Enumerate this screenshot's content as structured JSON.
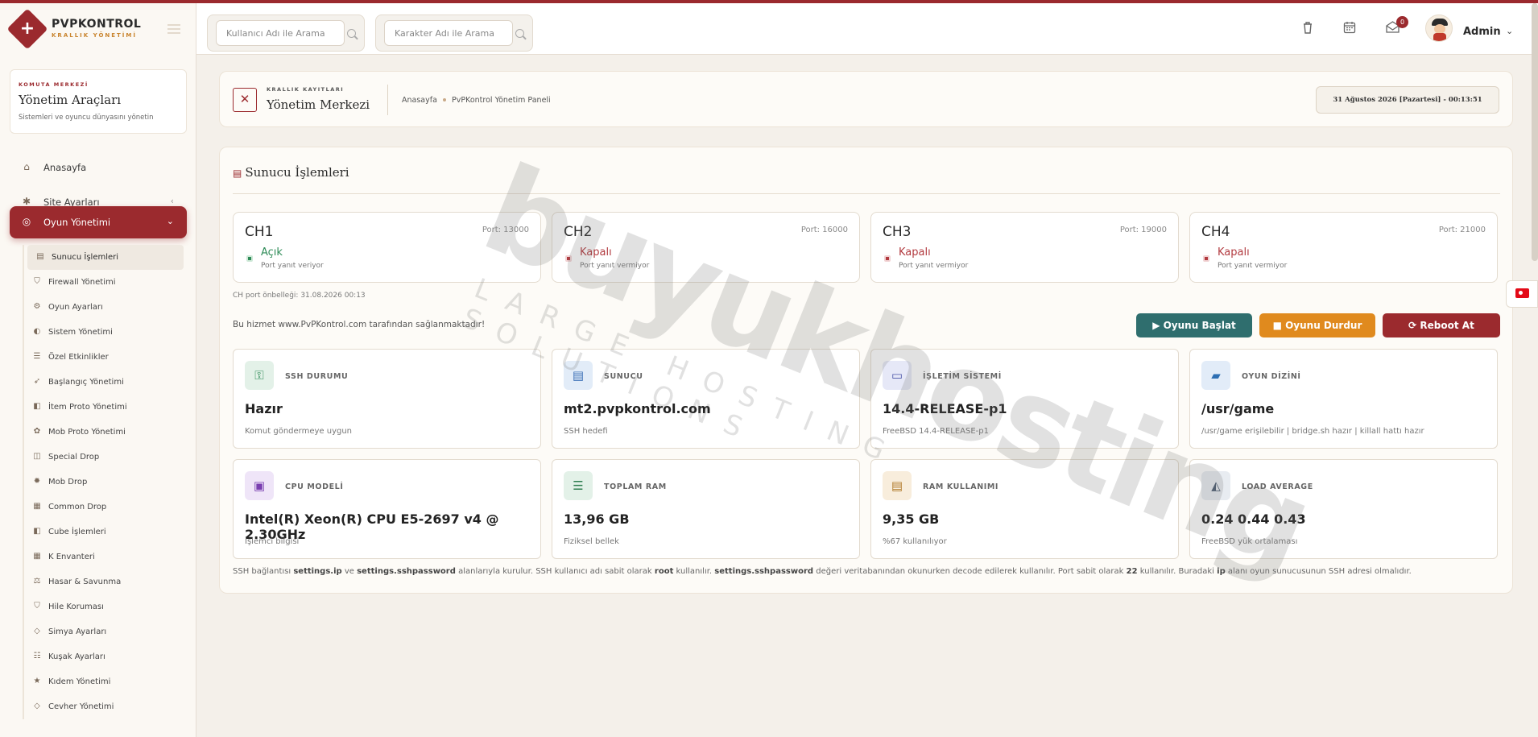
{
  "brand": {
    "title": "PVPKONTROL",
    "subtitle": "KRALLIK YÖNETİMİ"
  },
  "search": {
    "user_placeholder": "Kullanıcı Adı ile Arama",
    "character_placeholder": "Karakter Adı ile Arama"
  },
  "header": {
    "notification_count": "0",
    "admin_name": "Admin"
  },
  "sidebar": {
    "kicker": "KOMUTA MERKEZİ",
    "title": "Yönetim Araçları",
    "desc": "Sistemleri ve oyuncu dünyasını yönetin",
    "items": [
      {
        "label": "Anasayfa",
        "icon": "home-icon"
      },
      {
        "label": "Site Ayarları",
        "icon": "gear-icon"
      },
      {
        "label": "Oyun Yönetimi",
        "icon": "gamepad-icon"
      }
    ],
    "sub_items": [
      {
        "label": "Sunucu İşlemleri",
        "icon": "server-icon"
      },
      {
        "label": "Firewall Yönetimi",
        "icon": "shield-icon"
      },
      {
        "label": "Oyun Ayarları",
        "icon": "cogs-icon"
      },
      {
        "label": "Sistem Yönetimi",
        "icon": "toggle-icon"
      },
      {
        "label": "Özel Etkinlikler",
        "icon": "list-icon"
      },
      {
        "label": "Başlangıç Yönetimi",
        "icon": "rocket-icon"
      },
      {
        "label": "İtem Proto Yönetimi",
        "icon": "cube-icon"
      },
      {
        "label": "Mob Proto Yönetimi",
        "icon": "paw-icon"
      },
      {
        "label": "Special Drop",
        "icon": "gift-icon"
      },
      {
        "label": "Mob Drop",
        "icon": "bug-icon"
      },
      {
        "label": "Common Drop",
        "icon": "table-icon"
      },
      {
        "label": "Cube İşlemleri",
        "icon": "cube-icon"
      },
      {
        "label": "K Envanteri",
        "icon": "table-icon"
      },
      {
        "label": "Hasar & Savunma",
        "icon": "balance-icon"
      },
      {
        "label": "Hile Koruması",
        "icon": "shield-icon"
      },
      {
        "label": "Simya Ayarları",
        "icon": "diamond-icon"
      },
      {
        "label": "Kuşak Ayarları",
        "icon": "sliders-icon"
      },
      {
        "label": "Kıdem Yönetimi",
        "icon": "star-icon"
      },
      {
        "label": "Cevher Yönetimi",
        "icon": "diamond-icon"
      }
    ]
  },
  "page_header": {
    "kicker": "KRALLIK KAYITLARI",
    "title": "Yönetim Merkezi",
    "breadcrumb_home": "Anasayfa",
    "breadcrumb_current": "PvPKontrol Yönetim Paneli",
    "datetime": "31 Ağustos 2026 [Pazartesi] - 00:13:51"
  },
  "server": {
    "title": "Sunucu İşlemleri",
    "channels": [
      {
        "name": "CH1",
        "port": "Port: 13000",
        "status": "Açık",
        "note": "Port yanıt veriyor",
        "color": "#2e8b57"
      },
      {
        "name": "CH2",
        "port": "Port: 16000",
        "status": "Kapalı",
        "note": "Port yanıt vermiyor",
        "color": "#b23a3f"
      },
      {
        "name": "CH3",
        "port": "Port: 19000",
        "status": "Kapalı",
        "note": "Port yanıt vermiyor",
        "color": "#b23a3f"
      },
      {
        "name": "CH4",
        "port": "Port: 21000",
        "status": "Kapalı",
        "note": "Port yanıt vermiyor",
        "color": "#b23a3f"
      }
    ],
    "cache_note": "CH port önbelleği: 31.08.2026 00:13",
    "service_note": "Bu hizmet www.PvPKontrol.com tarafından sağlanmaktadır!",
    "buttons": {
      "start": "▶ Oyunu Başlat",
      "stop": "■ Oyunu Durdur",
      "reboot": "⟳ Reboot At",
      "start_color": "#2f6e6e",
      "stop_color": "#e08a1e",
      "reboot_color": "#9b2a2e"
    },
    "info_cards": [
      {
        "label": "SSH DURUMU",
        "value": "Hazır",
        "sub": "Komut göndermeye uygun",
        "icon": "key-icon"
      },
      {
        "label": "SUNUCU",
        "value": "mt2.pvpkontrol.com",
        "sub": "SSH hedefi",
        "icon": "server-icon"
      },
      {
        "label": "İŞLETİM SİSTEMİ",
        "value": "14.4-RELEASE-p1",
        "sub": "FreeBSD 14.4-RELEASE-p1",
        "icon": "monitor-icon"
      },
      {
        "label": "OYUN DİZİNİ",
        "value": "/usr/game",
        "sub": "/usr/game erişilebilir | bridge.sh hazır | killall hattı hazır",
        "icon": "folder-icon"
      },
      {
        "label": "CPU MODELİ",
        "value": "Intel(R) Xeon(R) CPU E5-2697 v4 @ 2.30GHz",
        "sub": "İşlemci bilgisi",
        "icon": "cpu-icon"
      },
      {
        "label": "TOPLAM RAM",
        "value": "13,96 GB",
        "sub": "Fiziksel bellek",
        "icon": "database-icon"
      },
      {
        "label": "RAM KULLANIMI",
        "value": "9,35 GB",
        "sub": "%67 kullanılıyor",
        "icon": "memory-icon"
      },
      {
        "label": "LOAD AVERAGE",
        "value": "0.24 0.44 0.43",
        "sub": "FreeBSD yük ortalaması",
        "icon": "area-chart-icon"
      }
    ],
    "footnote": {
      "p1": "SSH bağlantısı ",
      "b1": "settings.ip",
      "p2": " ve ",
      "b2": "settings.sshpassword",
      "p3": " alanlarıyla kurulur. SSH kullanıcı adı sabit olarak ",
      "b3": "root",
      "p4": " kullanılır. ",
      "b4": "settings.sshpassword",
      "p5": " değeri veritabanından okunurken decode edilerek kullanılır. Port sabit olarak ",
      "b5": "22",
      "p6": " kullanılır. Buradaki ",
      "b6": "ip",
      "p7": " alanı oyun sunucusunun SSH adresi olmalıdır."
    }
  },
  "watermark": {
    "main": "buyukhosting",
    "tagline": "LARGE HOSTING SOLUTIONS"
  }
}
